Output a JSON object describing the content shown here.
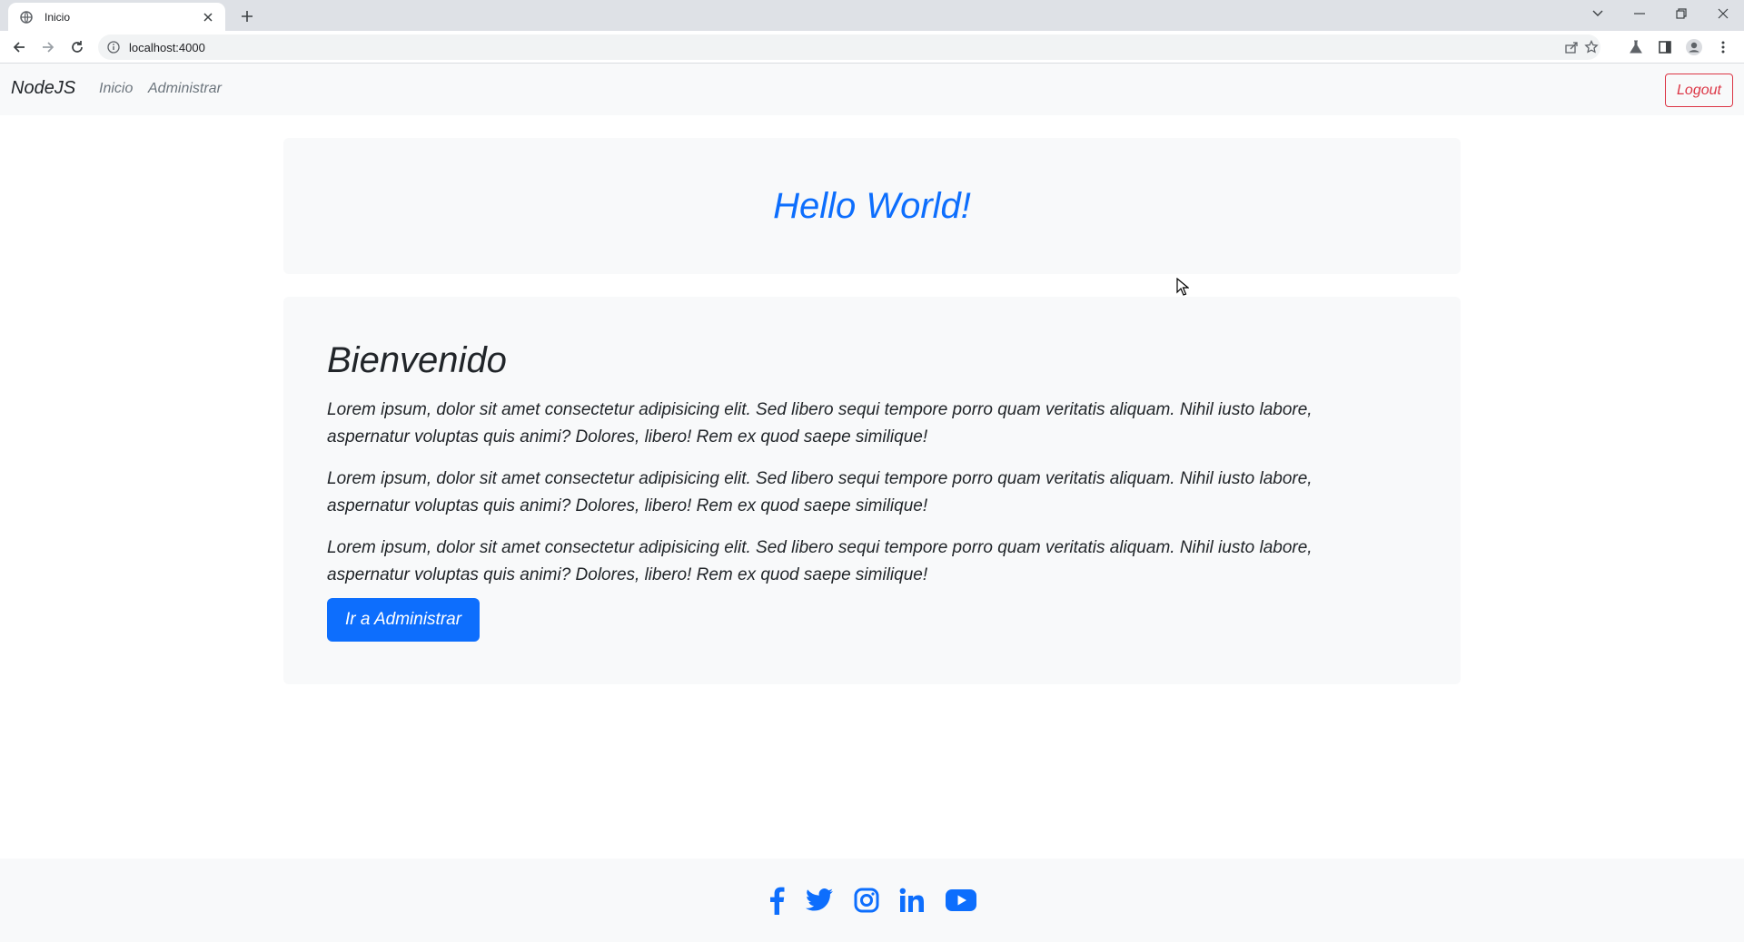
{
  "browser": {
    "tab_title": "Inicio",
    "url": "localhost:4000",
    "icons": [
      "globe-icon",
      "close-icon",
      "plus-icon",
      "back-icon",
      "forward-icon",
      "reload-icon",
      "info-icon",
      "share-icon",
      "star-icon",
      "flask-icon",
      "side-panel-icon",
      "profile-icon",
      "kebab-menu-icon",
      "chevron-down-icon",
      "minimize-icon",
      "restore-icon",
      "window-close-icon"
    ]
  },
  "navbar": {
    "brand": "NodeJS",
    "links": [
      "Inicio",
      "Administrar"
    ],
    "logout_label": "Logout"
  },
  "hero": {
    "title": "Hello World!"
  },
  "main": {
    "heading": "Bienvenido",
    "paragraphs": [
      "Lorem ipsum, dolor sit amet consectetur adipisicing elit. Sed libero sequi tempore porro quam veritatis aliquam. Nihil iusto labore, aspernatur voluptas quis animi? Dolores, libero! Rem ex quod saepe similique!",
      "Lorem ipsum, dolor sit amet consectetur adipisicing elit. Sed libero sequi tempore porro quam veritatis aliquam. Nihil iusto labore, aspernatur voluptas quis animi? Dolores, libero! Rem ex quod saepe similique!",
      "Lorem ipsum, dolor sit amet consectetur adipisicing elit. Sed libero sequi tempore porro quam veritatis aliquam. Nihil iusto labore, aspernatur voluptas quis animi? Dolores, libero! Rem ex quod saepe similique!"
    ],
    "button_label": "Ir a Administrar"
  },
  "footer": {
    "social_icons": [
      "facebook-icon",
      "twitter-icon",
      "instagram-icon",
      "linkedin-icon",
      "youtube-icon"
    ]
  },
  "colors": {
    "primary": "#0d6efd",
    "danger": "#dc3545",
    "light": "#f8f9fa",
    "muted": "#6c757d"
  }
}
